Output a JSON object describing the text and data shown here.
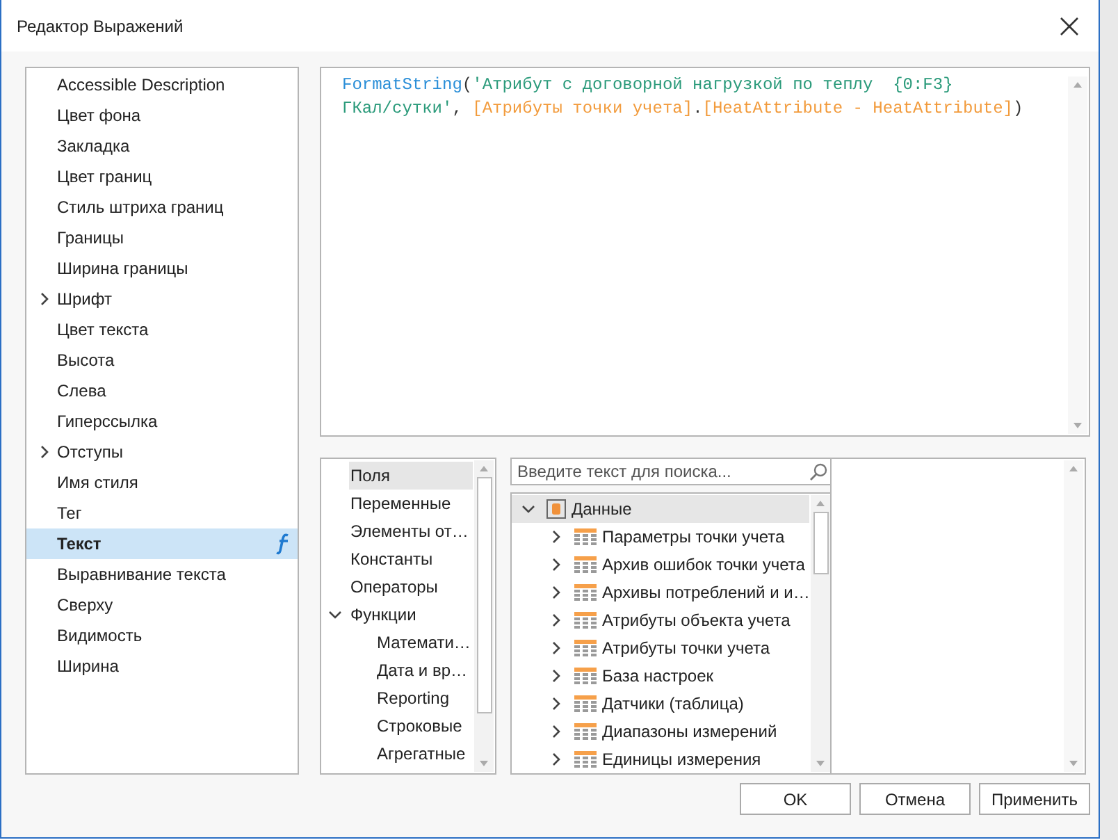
{
  "window": {
    "title": "Редактор Выражений"
  },
  "properties": [
    {
      "label": "Accessible Description",
      "expandable": false,
      "selected": false,
      "has_expression": false
    },
    {
      "label": "Цвет фона",
      "expandable": false,
      "selected": false,
      "has_expression": false
    },
    {
      "label": "Закладка",
      "expandable": false,
      "selected": false,
      "has_expression": false
    },
    {
      "label": "Цвет границ",
      "expandable": false,
      "selected": false,
      "has_expression": false
    },
    {
      "label": "Стиль штриха границ",
      "expandable": false,
      "selected": false,
      "has_expression": false
    },
    {
      "label": "Границы",
      "expandable": false,
      "selected": false,
      "has_expression": false
    },
    {
      "label": "Ширина границы",
      "expandable": false,
      "selected": false,
      "has_expression": false
    },
    {
      "label": "Шрифт",
      "expandable": true,
      "selected": false,
      "has_expression": false
    },
    {
      "label": "Цвет текста",
      "expandable": false,
      "selected": false,
      "has_expression": false
    },
    {
      "label": "Высота",
      "expandable": false,
      "selected": false,
      "has_expression": false
    },
    {
      "label": "Слева",
      "expandable": false,
      "selected": false,
      "has_expression": false
    },
    {
      "label": "Гиперссылка",
      "expandable": false,
      "selected": false,
      "has_expression": false
    },
    {
      "label": "Отступы",
      "expandable": true,
      "selected": false,
      "has_expression": false
    },
    {
      "label": "Имя стиля",
      "expandable": false,
      "selected": false,
      "has_expression": false
    },
    {
      "label": "Тег",
      "expandable": false,
      "selected": false,
      "has_expression": false
    },
    {
      "label": "Текст",
      "expandable": false,
      "selected": true,
      "has_expression": true
    },
    {
      "label": "Выравнивание текста",
      "expandable": false,
      "selected": false,
      "has_expression": false
    },
    {
      "label": "Сверху",
      "expandable": false,
      "selected": false,
      "has_expression": false
    },
    {
      "label": "Видимость",
      "expandable": false,
      "selected": false,
      "has_expression": false
    },
    {
      "label": "Ширина",
      "expandable": false,
      "selected": false,
      "has_expression": false
    }
  ],
  "expression": {
    "lines": [
      [
        {
          "text": "FormatString",
          "kind": "function"
        },
        {
          "text": "(",
          "kind": "punct"
        },
        {
          "text": "'Атрибут с договорной нагрузкой по теплу  {0:F3}",
          "kind": "string"
        }
      ],
      [
        {
          "text": "ГКал/сутки'",
          "kind": "string"
        },
        {
          "text": ", ",
          "kind": "punct"
        },
        {
          "text": "[Атрибуты точки учета]",
          "kind": "field"
        },
        {
          "text": ".",
          "kind": "punct"
        },
        {
          "text": "[HeatAttribute - HeatAttribute]",
          "kind": "field"
        },
        {
          "text": ")",
          "kind": "punct"
        }
      ]
    ]
  },
  "categories": [
    {
      "label": "Поля",
      "selected": true
    },
    {
      "label": "Переменные",
      "selected": false
    },
    {
      "label": "Элементы от…",
      "selected": false
    },
    {
      "label": "Константы",
      "selected": false
    },
    {
      "label": "Операторы",
      "selected": false
    },
    {
      "label": "Функции",
      "selected": false,
      "expanded": true,
      "children": [
        {
          "label": "Математи…",
          "selected": false
        },
        {
          "label": "Дата и вр…",
          "selected": false
        },
        {
          "label": "Reporting",
          "selected": false
        },
        {
          "label": "Строковые",
          "selected": false
        },
        {
          "label": "Агрегатные",
          "selected": false
        }
      ]
    }
  ],
  "search": {
    "placeholder": "Введите текст для поиска..."
  },
  "tree": [
    {
      "label": "Данные",
      "kind": "source",
      "selected": true,
      "expanded": true,
      "children": [
        {
          "label": "Параметры точки учета",
          "kind": "table",
          "selected": false,
          "expanded": false
        },
        {
          "label": "Архив ошибок точки учета",
          "kind": "table",
          "selected": false,
          "expanded": false
        },
        {
          "label": "Архивы потреблений и и…",
          "kind": "table",
          "selected": false,
          "expanded": false
        },
        {
          "label": "Атрибуты объекта учета",
          "kind": "table",
          "selected": false,
          "expanded": false
        },
        {
          "label": "Атрибуты точки учета",
          "kind": "table",
          "selected": false,
          "expanded": false
        },
        {
          "label": "База настроек",
          "kind": "table",
          "selected": false,
          "expanded": false
        },
        {
          "label": "Датчики (таблица)",
          "kind": "table",
          "selected": false,
          "expanded": false
        },
        {
          "label": "Диапазоны измерений",
          "kind": "table",
          "selected": false,
          "expanded": false
        },
        {
          "label": "Единицы измерения",
          "kind": "table",
          "selected": false,
          "expanded": false
        }
      ]
    }
  ],
  "buttons": [
    "OK",
    "Отмена",
    "Применить"
  ]
}
